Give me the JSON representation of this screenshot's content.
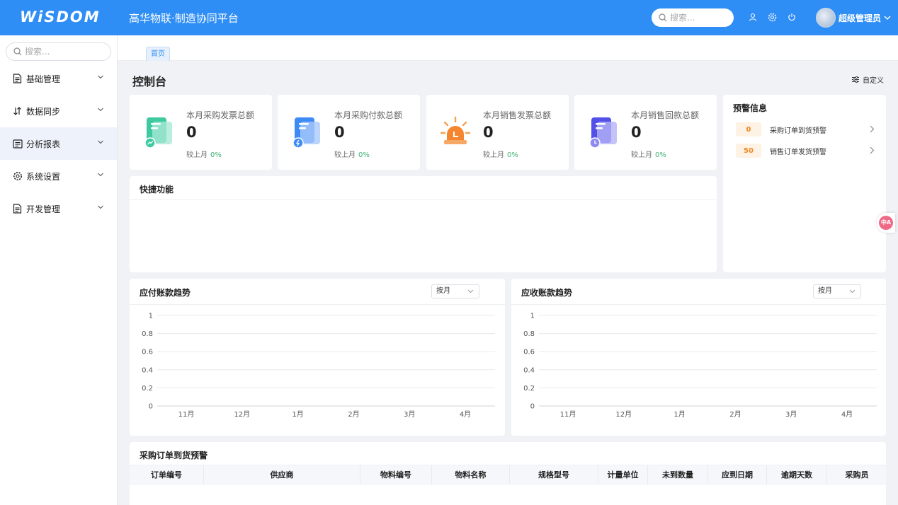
{
  "header": {
    "logo": "WiSDOM",
    "title": "高华物联·制造协同平台",
    "search_placeholder": "搜索...",
    "username": "超级管理员"
  },
  "sidebar": {
    "search_placeholder": "搜索...",
    "items": [
      {
        "label": "基础管理",
        "icon": "document-icon"
      },
      {
        "label": "数据同步",
        "icon": "sync-arrows-icon"
      },
      {
        "label": "分析报表",
        "icon": "report-icon"
      },
      {
        "label": "系统设置",
        "icon": "gear-icon"
      },
      {
        "label": "开发管理",
        "icon": "document-icon"
      }
    ],
    "active_index": 2
  },
  "tabs": [
    {
      "label": "首页"
    }
  ],
  "page": {
    "title": "控制台",
    "customize_label": "自定义"
  },
  "stats": [
    {
      "label": "本月采购发票总额",
      "value": "0",
      "compare_label": "较上月",
      "compare_value": "0%",
      "color": "#3ec9a0",
      "icon": "invoice-chart-icon"
    },
    {
      "label": "本月采购付款总额",
      "value": "0",
      "compare_label": "较上月",
      "compare_value": "0%",
      "color": "#3f8bf5",
      "icon": "payment-icon"
    },
    {
      "label": "本月销售发票总额",
      "value": "0",
      "compare_label": "较上月",
      "compare_value": "0%",
      "color": "#f5862f",
      "icon": "alarm-light-icon"
    },
    {
      "label": "本月销售回款总额",
      "value": "0",
      "compare_label": "较上月",
      "compare_value": "0%",
      "color": "#5250e8",
      "icon": "clock-document-icon"
    }
  ],
  "alerts": {
    "title": "预警信息",
    "items": [
      {
        "count": "0",
        "label": "采购订单到货预警"
      },
      {
        "count": "50",
        "label": "销售订单发货预警"
      }
    ]
  },
  "quick": {
    "title": "快捷功能"
  },
  "charts": [
    {
      "title": "应付账款趋势",
      "select_value": "按月",
      "chart_data": {
        "type": "line",
        "categories": [
          "11月",
          "12月",
          "1月",
          "2月",
          "3月",
          "4月"
        ],
        "series": [
          {
            "values": [
              0,
              0,
              0,
              0,
              0,
              0
            ]
          }
        ],
        "yticks": [
          "0",
          "0.2",
          "0.4",
          "0.6",
          "0.8",
          "1"
        ],
        "ylim": [
          0,
          1
        ],
        "grid": true,
        "colors": [
          "#2ad9e0",
          "#1f6fe8"
        ]
      }
    },
    {
      "title": "应收账款趋势",
      "select_value": "按月",
      "chart_data": {
        "type": "line",
        "categories": [
          "11月",
          "12月",
          "1月",
          "2月",
          "3月",
          "4月"
        ],
        "series": [
          {
            "values": [
              0,
              0,
              0,
              0,
              0,
              0
            ]
          }
        ],
        "yticks": [
          "0",
          "0.2",
          "0.4",
          "0.6",
          "0.8",
          "1"
        ],
        "ylim": [
          0,
          1
        ],
        "grid": true,
        "colors": [
          "#2ad9e0",
          "#6a2be8"
        ]
      }
    }
  ],
  "table": {
    "title": "采购订单到货预警",
    "columns": [
      "订单编号",
      "供应商",
      "物料编号",
      "物料名称",
      "规格型号",
      "计量单位",
      "未到数量",
      "应到日期",
      "逾期天数",
      "采购员"
    ]
  }
}
